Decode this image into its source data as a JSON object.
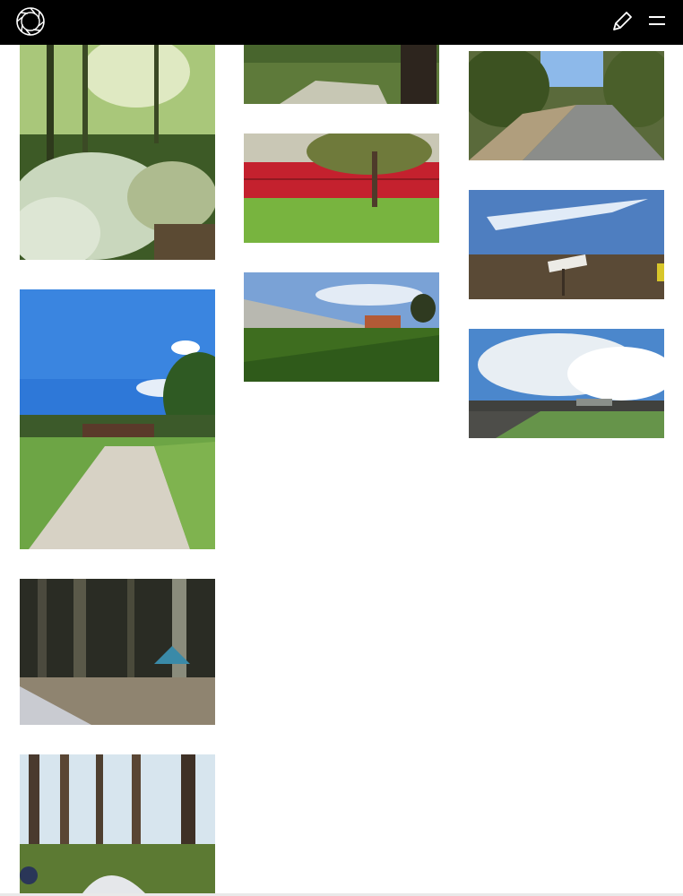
{
  "header": {
    "logo_icon": "aperture-logo-icon",
    "edit_icon": "pencil-icon",
    "menu_icon": "hamburger-menu-icon"
  },
  "gallery": {
    "columns": [
      {
        "photos": [
          {
            "subject": "forest-path-with-groundcover"
          },
          {
            "subject": "gravel-trail-to-bridge"
          },
          {
            "subject": "forest-campsite-through-tent"
          },
          {
            "subject": "pine-forest-with-tent"
          }
        ]
      },
      {
        "photos": [
          {
            "subject": "creek-bed-with-tree-trunk"
          },
          {
            "subject": "tree-before-red-wall"
          },
          {
            "subject": "retaining-wall-and-grass"
          }
        ]
      },
      {
        "photos": [
          {
            "subject": "river-between-trees"
          },
          {
            "subject": "field-with-sign"
          },
          {
            "subject": "cloudy-sky-over-highway"
          }
        ]
      }
    ]
  },
  "colors": {
    "header_bg": "#000000",
    "page_bg": "#ffffff"
  }
}
